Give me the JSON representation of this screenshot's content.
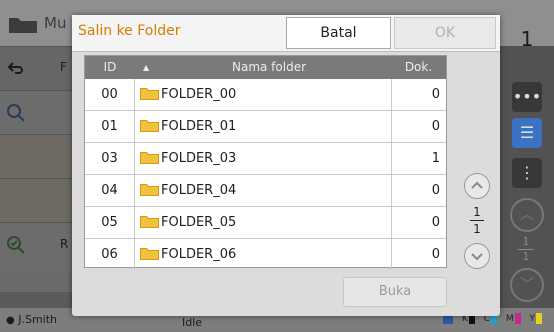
{
  "background": {
    "app_title_partial": "Mu",
    "page_number": "1",
    "left_labels": [
      "F",
      "R"
    ],
    "user": "J.Smith",
    "status": "Idle",
    "toner_labels": [
      "K",
      "C",
      "M",
      "Y"
    ],
    "right_pager": {
      "current": "1",
      "total": "1"
    }
  },
  "dialog": {
    "title": "Salin ke Folder",
    "cancel_label": "Batal",
    "ok_label": "OK",
    "open_label": "Buka",
    "columns": {
      "id": "ID",
      "name": "Nama folder",
      "docs": "Dok."
    },
    "rows": [
      {
        "id": "00",
        "name": "FOLDER_00",
        "docs": "0"
      },
      {
        "id": "01",
        "name": "FOLDER_01",
        "docs": "0"
      },
      {
        "id": "03",
        "name": "FOLDER_03",
        "docs": "1"
      },
      {
        "id": "04",
        "name": "FOLDER_04",
        "docs": "0"
      },
      {
        "id": "05",
        "name": "FOLDER_05",
        "docs": "0"
      },
      {
        "id": "06",
        "name": "FOLDER_06",
        "docs": "0"
      }
    ],
    "pager": {
      "current": "1",
      "total": "1"
    },
    "colors": {
      "title": "#d97a00",
      "folder_icon": "#f2c23a",
      "header_bg": "#7a7a7a"
    }
  }
}
